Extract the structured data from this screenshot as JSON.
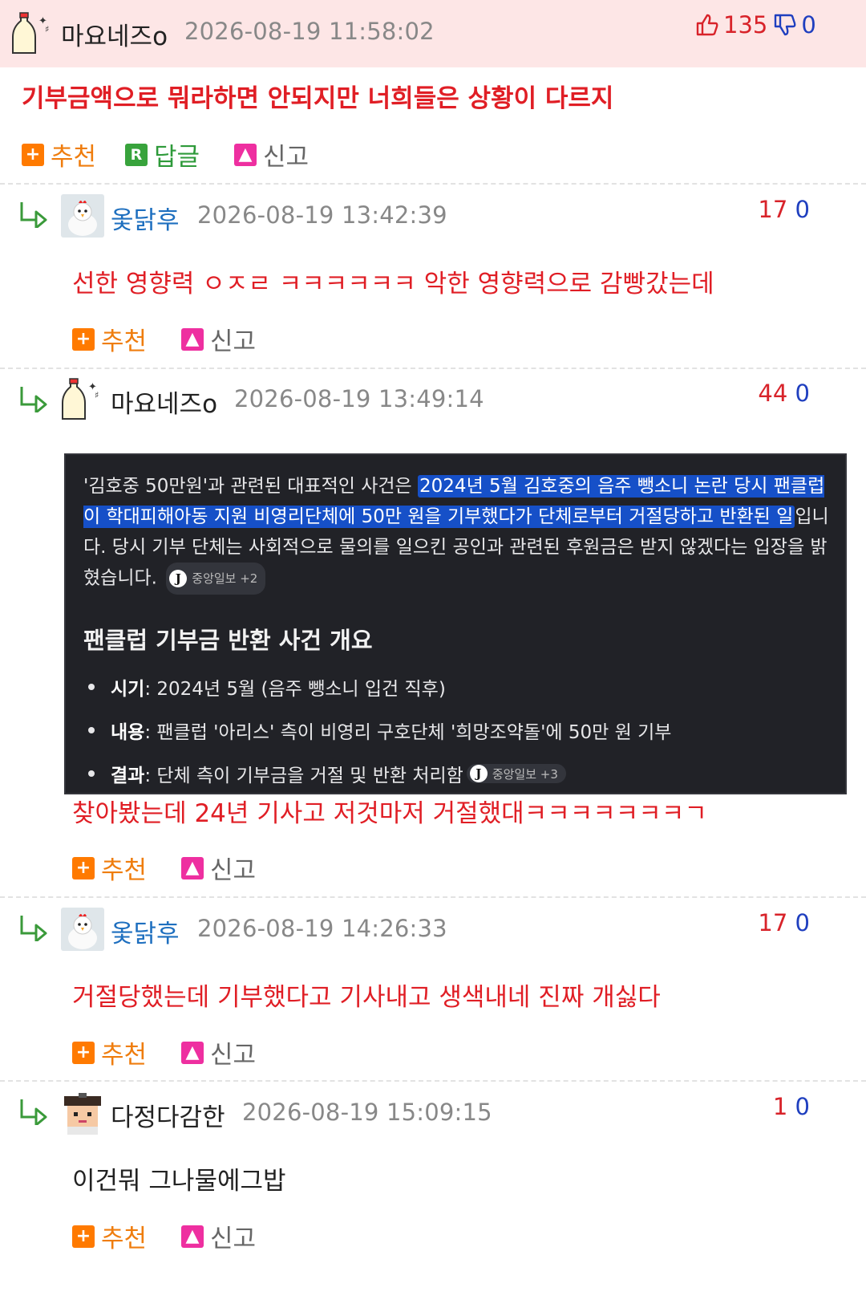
{
  "post": {
    "author": "마요네즈o",
    "date": "2026-08-19 11:58:02",
    "up": "135",
    "down": "0",
    "title": "기부금액으로 뭐라하면 안되지만 너희들은 상황이 다르지",
    "actions": {
      "recommend": "추천",
      "reply": "답글",
      "report": "신고"
    }
  },
  "comments": [
    {
      "author": "옻닭후",
      "date": "2026-08-19 13:42:39",
      "up": "17",
      "down": "0",
      "text": "선한 영향력 ㅇㅈㄹ ㅋㅋㅋㅋㅋㅋ 악한 영향력으로 감빵갔는데",
      "recommend": "추천",
      "report": "신고"
    },
    {
      "author": "마요네즈o",
      "date": "2026-08-19 13:49:14",
      "up": "44",
      "down": "0",
      "text": "찾아봤는데 24년 기사고 저것마저 거절했대ㅋㅋㅋㅋㅋㅋㅋㄱ",
      "recommend": "추천",
      "report": "신고",
      "screenshot": {
        "intro_pre": "'김호중 50만원'과 관련된 대표적인 사건은 ",
        "intro_hl": "2024년 5월 김호중의 음주 뺑소니 논란 당시 팬클럽이 학대피해아동 지원 비영리단체에 50만 원을 기부했다가 단체로부터 거절당하고 반환된 일",
        "intro_post": "입니다. 당시 기부 단체는 사회적으로 물의를 일으킨 공인과 관련된 후원금은 받지 않겠다는 입장을 밝혔습니다.",
        "source1": "중앙일보 +2",
        "heading": "팬클럽 기부금 반환 사건 개요",
        "bullets": [
          {
            "label": "시기",
            "text": ": 2024년 5월 (음주 뺑소니 입건 직후)"
          },
          {
            "label": "내용",
            "text": ": 팬클럽 '아리스' 측이 비영리 구호단체 '희망조약돌'에 50만 원 기부"
          },
          {
            "label": "결과",
            "text": ": 단체 측이 기부금을 거절 및 반환 처리함"
          }
        ],
        "source2": "중앙일보 +3",
        "source_icon": "J"
      }
    },
    {
      "author": "옻닭후",
      "date": "2026-08-19 14:26:33",
      "up": "17",
      "down": "0",
      "text": "거절당했는데 기부했다고 기사내고 생색내네 진짜 개싫다",
      "recommend": "추천",
      "report": "신고"
    },
    {
      "author": "다정다감한",
      "date": "2026-08-19 15:09:15",
      "up": "1",
      "down": "0",
      "text": "이건뭐 그나물에그밥",
      "recommend": "추천",
      "report": "신고"
    }
  ],
  "colors": {
    "accent_red": "#e01e25",
    "header_bg": "#fde6e6",
    "name_blue": "#1e6fbf",
    "highlight": "#1650c8"
  }
}
